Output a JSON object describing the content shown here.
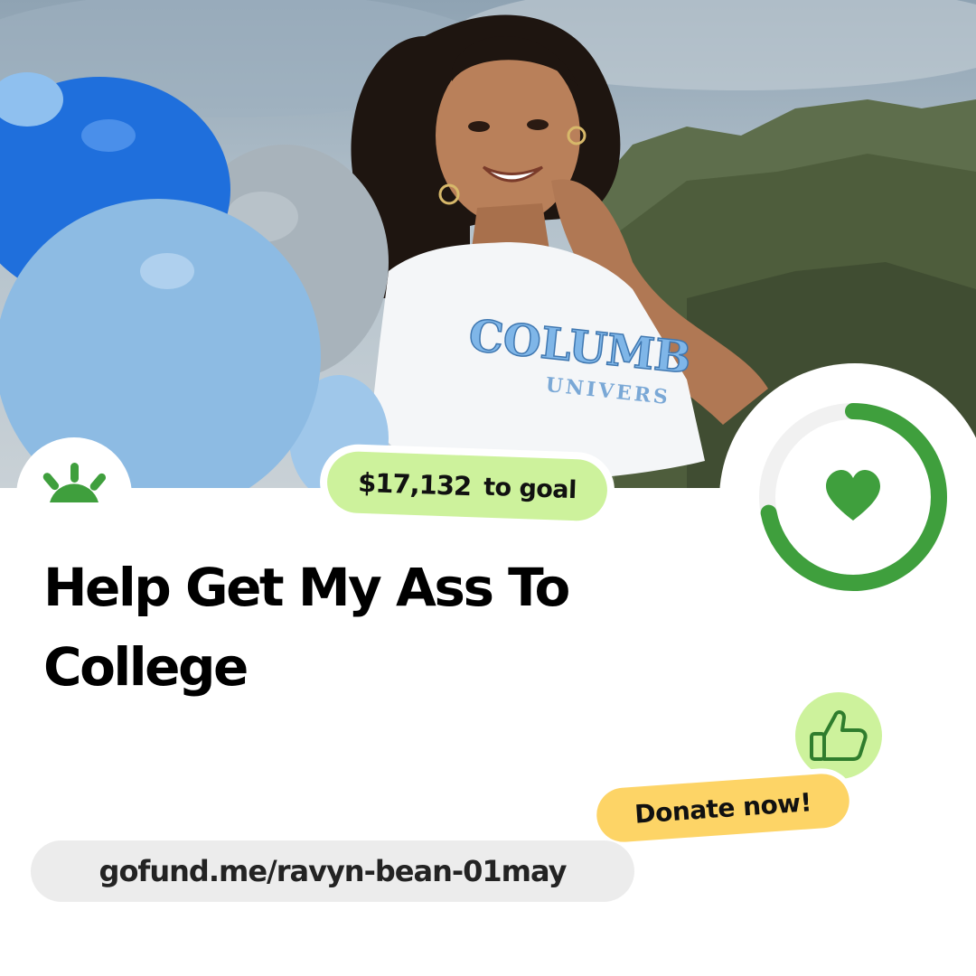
{
  "campaign": {
    "title": "Help Get My Ass To College",
    "url": "gofund.me/ravyn-bean-01may"
  },
  "goal": {
    "amount": "$17,132",
    "label": "to goal",
    "progress_fraction": 0.72
  },
  "cta": {
    "donate_label": "Donate now!"
  },
  "photo": {
    "shirt_text_top": "COLUMB",
    "shirt_text_bottom": "UNIVERS"
  },
  "icons": {
    "logo": "gofundme-sunrise-logo-icon",
    "ring_center": "heart-icon",
    "badge": "thumbs-up-icon"
  },
  "colors": {
    "brand_green": "#3f9f3d",
    "pill_green": "#cdf29c",
    "donate_yellow": "#fdd466",
    "url_gray": "#ececec",
    "ring_track": "#f1f1f1"
  }
}
